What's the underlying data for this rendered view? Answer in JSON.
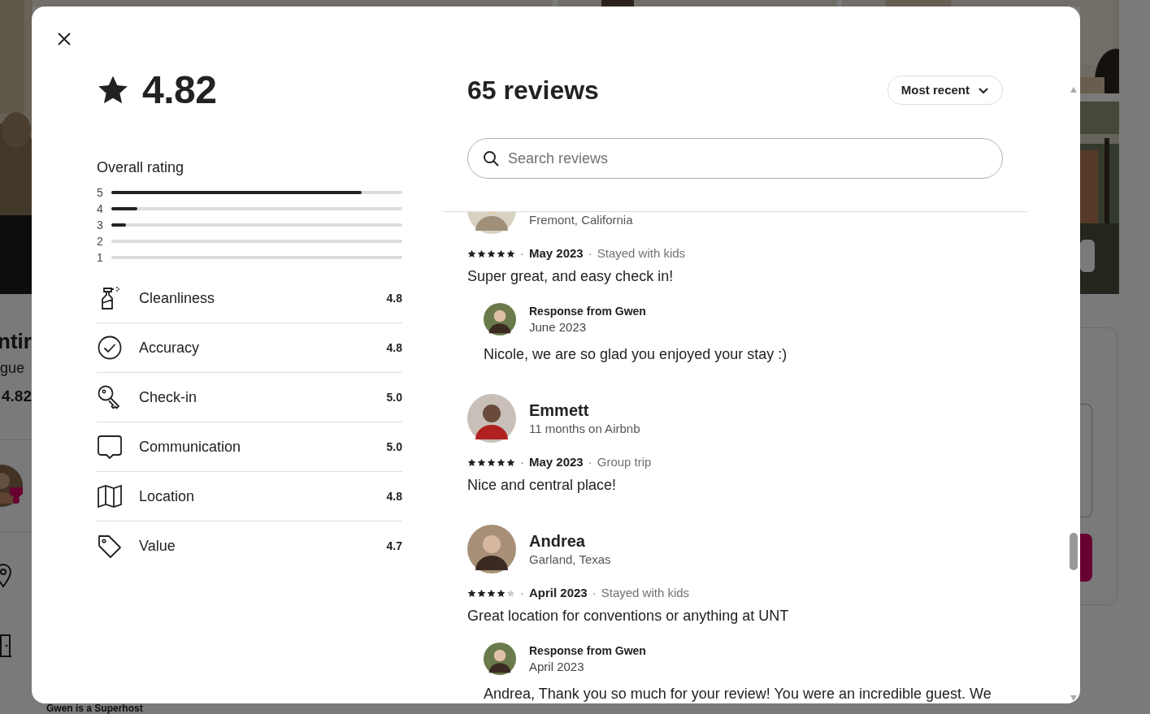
{
  "background_page": {
    "heading": "ntir",
    "subtitle": "gue",
    "rating": "4.82",
    "host_heading": "Gwen is a Superhost"
  },
  "summary": {
    "rating": "4.82",
    "overall_title": "Overall rating",
    "bars": [
      {
        "label": "5",
        "level": 0.86
      },
      {
        "label": "4",
        "level": 0.09
      },
      {
        "label": "3",
        "level": 0.05
      },
      {
        "label": "2",
        "level": 0
      },
      {
        "label": "1",
        "level": 0
      }
    ],
    "categories": [
      {
        "kind": "spray",
        "label": "Cleanliness",
        "score": "4.8"
      },
      {
        "kind": "check",
        "label": "Accuracy",
        "score": "4.8"
      },
      {
        "kind": "key",
        "label": "Check-in",
        "score": "5.0"
      },
      {
        "kind": "chat",
        "label": "Communication",
        "score": "5.0"
      },
      {
        "kind": "map",
        "label": "Location",
        "score": "4.8"
      },
      {
        "kind": "tag",
        "label": "Value",
        "score": "4.7"
      }
    ]
  },
  "reviews": {
    "title": "65 reviews",
    "sort": "Most recent",
    "search_placeholder": "Search reviews",
    "items": [
      {
        "subtitle": "Fremont, California",
        "stars": 5,
        "separator": "·",
        "date": "May 2023",
        "trip": "Stayed with kids",
        "text": "Super great, and easy check in!",
        "response": {
          "title": "Response from Gwen",
          "date": "June 2023",
          "text": "Nicole, we are so glad you enjoyed your stay :)"
        }
      },
      {
        "name": "Emmett",
        "subtitle": "11 months on Airbnb",
        "stars": 5,
        "separator": "·",
        "date": "May 2023",
        "trip": "Group trip",
        "text": "Nice and central place!"
      },
      {
        "name": "Andrea",
        "subtitle": "Garland, Texas",
        "stars": 4,
        "separator": "·",
        "date": "April 2023",
        "trip": "Stayed with kids",
        "text": "Great location for conventions or anything at UNT",
        "response": {
          "title": "Response from Gwen",
          "date": "April 2023",
          "text": "Andrea, Thank you so much for your review! You were an incredible guest. We"
        }
      }
    ]
  }
}
